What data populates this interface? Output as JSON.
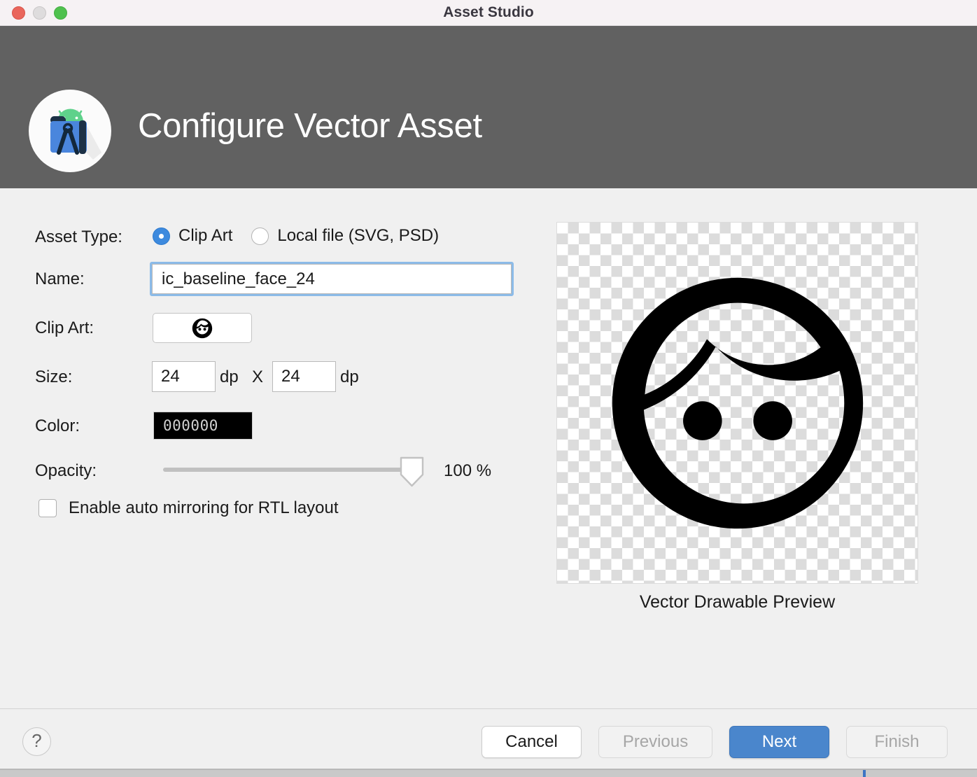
{
  "window": {
    "title": "Asset Studio",
    "traffic_lights": [
      "close",
      "minimize",
      "maximize"
    ]
  },
  "banner": {
    "title": "Configure Vector Asset",
    "logo": "android-studio-logo",
    "background_color": "#616161"
  },
  "form": {
    "asset_type": {
      "label": "Asset Type:",
      "options": [
        {
          "label": "Clip Art",
          "selected": true
        },
        {
          "label": "Local file (SVG, PSD)",
          "selected": false
        }
      ]
    },
    "name": {
      "label": "Name:",
      "value": "ic_baseline_face_24",
      "placeholder": "ic_baseline_face_24",
      "focused": true,
      "focus_color": "#8cbbe8"
    },
    "clip_art": {
      "label": "Clip Art:",
      "icon": "face-icon"
    },
    "size": {
      "label": "Size:",
      "width": "24",
      "height": "24",
      "unit_width": "dp",
      "separator": "X",
      "unit_height": "dp"
    },
    "color": {
      "label": "Color:",
      "value": "000000",
      "swatch_hex": "#000000"
    },
    "opacity": {
      "label": "Opacity:",
      "value": "100 %",
      "percent": 100
    },
    "rtl": {
      "label": "Enable auto mirroring for RTL layout",
      "checked": false
    }
  },
  "preview": {
    "caption": "Vector Drawable Preview",
    "icon": "face-icon",
    "icon_color": "#000000"
  },
  "footer": {
    "help_label": "?",
    "buttons": [
      {
        "id": "cancel",
        "label": "Cancel",
        "enabled": true,
        "primary": false
      },
      {
        "id": "previous",
        "label": "Previous",
        "enabled": false,
        "primary": false
      },
      {
        "id": "next",
        "label": "Next",
        "enabled": true,
        "primary": true
      },
      {
        "id": "finish",
        "label": "Finish",
        "enabled": false,
        "primary": false
      }
    ],
    "primary_color": "#4a86cc"
  }
}
